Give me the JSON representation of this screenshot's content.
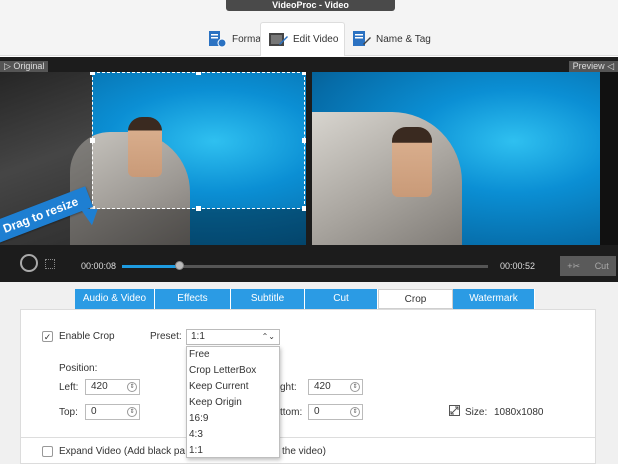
{
  "window": {
    "title": "VideoProc - Video"
  },
  "top_tabs": [
    {
      "label": "Format",
      "icon": "format-icon"
    },
    {
      "label": "Edit Video",
      "icon": "edit-video-icon",
      "active": true
    },
    {
      "label": "Name & Tag",
      "icon": "name-tag-icon"
    }
  ],
  "preview": {
    "original_label": "Original",
    "preview_label": "Preview",
    "drag_hint": "Drag to resize"
  },
  "playback": {
    "current_time": "00:00:08",
    "end_time": "00:00:52",
    "progress_fraction": 0.155,
    "cut_label": "Cut"
  },
  "edit_tabs": [
    "Audio & Video",
    "Effects",
    "Subtitle",
    "Cut",
    "Crop",
    "Watermark"
  ],
  "active_edit_tab": "Crop",
  "crop": {
    "enable_label": "Enable Crop",
    "enabled": true,
    "preset_label": "Preset:",
    "preset_value": "1:1",
    "preset_options": [
      "Free",
      "Crop LetterBox",
      "Keep Current",
      "Keep Origin",
      "16:9",
      "4:3",
      "1:1"
    ],
    "position_label": "Position:",
    "left_label": "Left:",
    "left_value": "420",
    "top_label": "Top:",
    "top_value": "0",
    "right_label": "ght:",
    "right_value": "420",
    "bottom_label": "ttom:",
    "bottom_value": "0",
    "size_label": "Size:",
    "size_value": "1080x1080",
    "expand_text_a": "Expand Video (Add black pa",
    "expand_text_b": "the video)"
  },
  "colors": {
    "accent": "#2b9be4",
    "titlebar": "#4a4a4a",
    "video_bg": "#1c1c1c"
  }
}
